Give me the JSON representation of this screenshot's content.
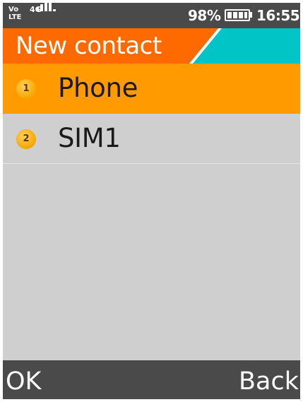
{
  "status_bar": {
    "volte_line1": "Vo",
    "volte_line2": "LTE",
    "network": "4G",
    "battery_percent": "98%",
    "time": "16:55"
  },
  "title_bar": {
    "title": "New contact"
  },
  "menu": {
    "items": [
      {
        "number": "1",
        "label": "Phone",
        "selected": true
      },
      {
        "number": "2",
        "label": "SIM1",
        "selected": false
      }
    ]
  },
  "softkeys": {
    "left": "OK",
    "right": "Back"
  },
  "colors": {
    "title_orange": "#ff6a00",
    "title_cyan": "#00c4c6",
    "selected_row": "#ff9a00",
    "bars": "#4a4a4a",
    "list_bg": "#cfcfcf"
  }
}
